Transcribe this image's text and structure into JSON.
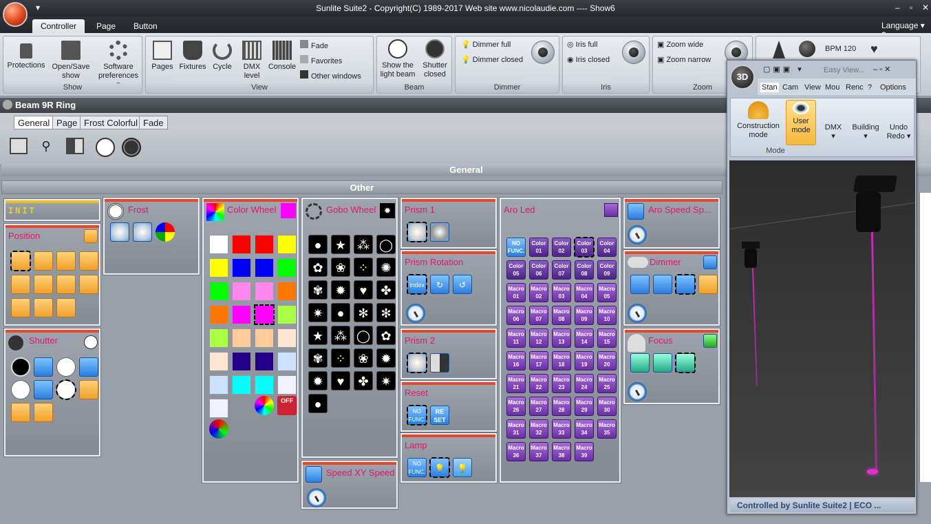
{
  "window": {
    "title": "Sunlite Suite2 - Copyright(C) 1989-2017    Web site www.nicolaudie.com ---- Show6",
    "language": "Language"
  },
  "ribbon_tabs": [
    "Controller",
    "Page",
    "Button"
  ],
  "ribbon": {
    "show": {
      "label": "Show",
      "protections": "Protections",
      "open_save": "Open/Save show",
      "software": "Software preferences"
    },
    "view": {
      "label": "View",
      "pages": "Pages",
      "fixtures": "Fixtures",
      "cycle": "Cycle",
      "dmx": "DMX level",
      "console": "Console",
      "fade": "Fade",
      "favorites": "Favorites",
      "other": "Other windows"
    },
    "beam": {
      "label": "Beam",
      "show_light": "Show the light beam",
      "shutter_closed": "Shutter closed"
    },
    "dimmer": {
      "label": "Dimmer",
      "full": "Dimmer full",
      "closed": "Dimmer closed"
    },
    "iris": {
      "label": "Iris",
      "full": "Iris full",
      "closed": "Iris closed"
    },
    "zoom": {
      "label": "Zoom",
      "wide": "Zoom wide",
      "narrow": "Zoom narrow"
    },
    "bpm": "BPM 120"
  },
  "fixture": {
    "name": "Beam 9R Ring",
    "tabs": [
      "General",
      "Page",
      "Frost Colorful",
      "Fade"
    ],
    "section": "General",
    "subsection": "Other"
  },
  "panels": {
    "init": "INIT",
    "position": "Position",
    "shutter": "Shutter",
    "frost": "Frost",
    "color_wheel": "Color Wheel",
    "gobo_wheel": "Gobo Wheel",
    "speed_xy": "Speed XY Speed",
    "prism1": "Prism 1",
    "prism_rotation": "Prism Rotation",
    "prism2": "Prism 2",
    "reset": "Reset",
    "lamp": "Lamp",
    "aro_led": "Aro Led",
    "aro_speed": "Aro Speed Sp...",
    "dimmer": "Dimmer",
    "focus": "Focus"
  },
  "aro_led": {
    "first": "NO FUNC.",
    "colors": [
      "Color 01",
      "Color 02",
      "Color 03",
      "Color 04",
      "Color 05",
      "Color 06",
      "Color 07",
      "Color 08",
      "Color 09"
    ],
    "macros": [
      "Macro 01",
      "Macro 02",
      "Macro 03",
      "Macro 04",
      "Macro 05",
      "Macro 06",
      "Macro 07",
      "Macro 08",
      "Macro 09",
      "Macro 10",
      "Macro 11",
      "Macro 12",
      "Macro 13",
      "Macro 14",
      "Macro 15",
      "Macro 16",
      "Macro 17",
      "Macro 18",
      "Macro 19",
      "Macro 20",
      "Macro 21",
      "Macro 22",
      "Macro 23",
      "Macro 24",
      "Macro 25",
      "Macro 26",
      "Macro 27",
      "Macro 28",
      "Macro 29",
      "Macro 30",
      "Macro 31",
      "Macro 32",
      "Macro 33",
      "Macro 34",
      "Macro 35",
      "Macro 36",
      "Macro 37",
      "Macro 38",
      "Macro 39"
    ]
  },
  "colors_wheel": [
    "#ffffff",
    "#ff0000",
    "#ff0000",
    "#ffff00",
    "#ffff00",
    "#0000ff",
    "#0000ff",
    "#00ff00",
    "#00ff00",
    "#ff88ee",
    "#ff88ee",
    "#ff7700",
    "#ff7700",
    "#ff00ff",
    "#ff00ff",
    "#aaff44",
    "#aaff44",
    "#ffcc99",
    "#ffcc99",
    "#ffe4d0",
    "#ffe4d0",
    "#220088",
    "#220088",
    "#cce0ff",
    "#cce0ff",
    "#00ffff",
    "#00ffff",
    "#f2f2ff",
    "#f2f2ff"
  ],
  "small_labels": {
    "index": "Index",
    "no_func": "NO FUNC.",
    "reset": "RE SET",
    "off": "OFF"
  },
  "w3d": {
    "badge": "3D",
    "easy_view": "Easy View...",
    "tabs": [
      "Stan",
      "Cam",
      "View",
      "Mou",
      "Renc",
      "?",
      "Options"
    ],
    "construction": "Construction mode",
    "user": "User mode",
    "dmx": "DMX",
    "building": "Building",
    "undo": "Undo Redo",
    "mode_label": "Mode",
    "status": "Controlled by Sunlite Suite2  |  ECO ..."
  }
}
